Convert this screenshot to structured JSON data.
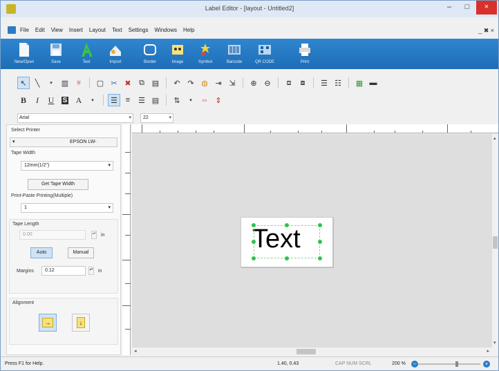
{
  "window": {
    "title": "Label Editor - [layout - Untitled2]",
    "controls": {
      "minimize": "–",
      "maximize": "□",
      "close": "×"
    }
  },
  "menu": {
    "items": [
      "File",
      "Edit",
      "View",
      "Insert",
      "Layout",
      "Text",
      "Settings",
      "Windows",
      "Help"
    ],
    "mdi_controls": "_ ✖ ×"
  },
  "ribbon": {
    "buttons": [
      {
        "label": "New/Open",
        "icon": "document-icon"
      },
      {
        "label": "Save",
        "icon": "save-icon"
      },
      {
        "label": "Text",
        "icon": "text-icon"
      },
      {
        "label": "Import",
        "icon": "import-icon"
      },
      {
        "label": "Border",
        "icon": "border-icon"
      },
      {
        "label": "Image",
        "icon": "image-icon"
      },
      {
        "label": "Symbol",
        "icon": "symbol-icon"
      },
      {
        "label": "Barcode",
        "icon": "barcode-icon"
      },
      {
        "label": "QR CODE",
        "icon": "qrcode-icon"
      },
      {
        "label": "Print",
        "icon": "printer-icon"
      }
    ]
  },
  "formatting": {
    "font_name": "Arial",
    "font_size": "22",
    "bold": "B",
    "italic": "I",
    "underline": "U",
    "text_style": "A"
  },
  "panel": {
    "select_printer_label": "Select Printer",
    "printer_value": "EPSON LW-",
    "tape_width_label": "Tape Width",
    "tape_width_value": "12mm(1/2\")",
    "get_tape_width_button": "Get Tape Width",
    "print_paste_label": "Print-Paste Printing(Multiple)",
    "print_paste_value": "1",
    "tape_length_label": "Tape Length",
    "tape_length_value": "0.00",
    "tape_length_unit": "in",
    "auto_button": "Auto",
    "manual_button": "Manual",
    "margins_label": "Margins",
    "margins_value": "0.12",
    "margins_unit": "in",
    "alignment_label": "Alignment"
  },
  "canvas": {
    "label_text": "Text"
  },
  "status": {
    "help": "Press F1 for Help.",
    "coords": "1.40, 0.43",
    "keys": "CAP  NUM  SCRL",
    "zoom": "200 %"
  },
  "colors": {
    "ribbon_blue": "#1d6db6",
    "handle_green": "#2ec44a",
    "close_red": "#d9302b"
  }
}
